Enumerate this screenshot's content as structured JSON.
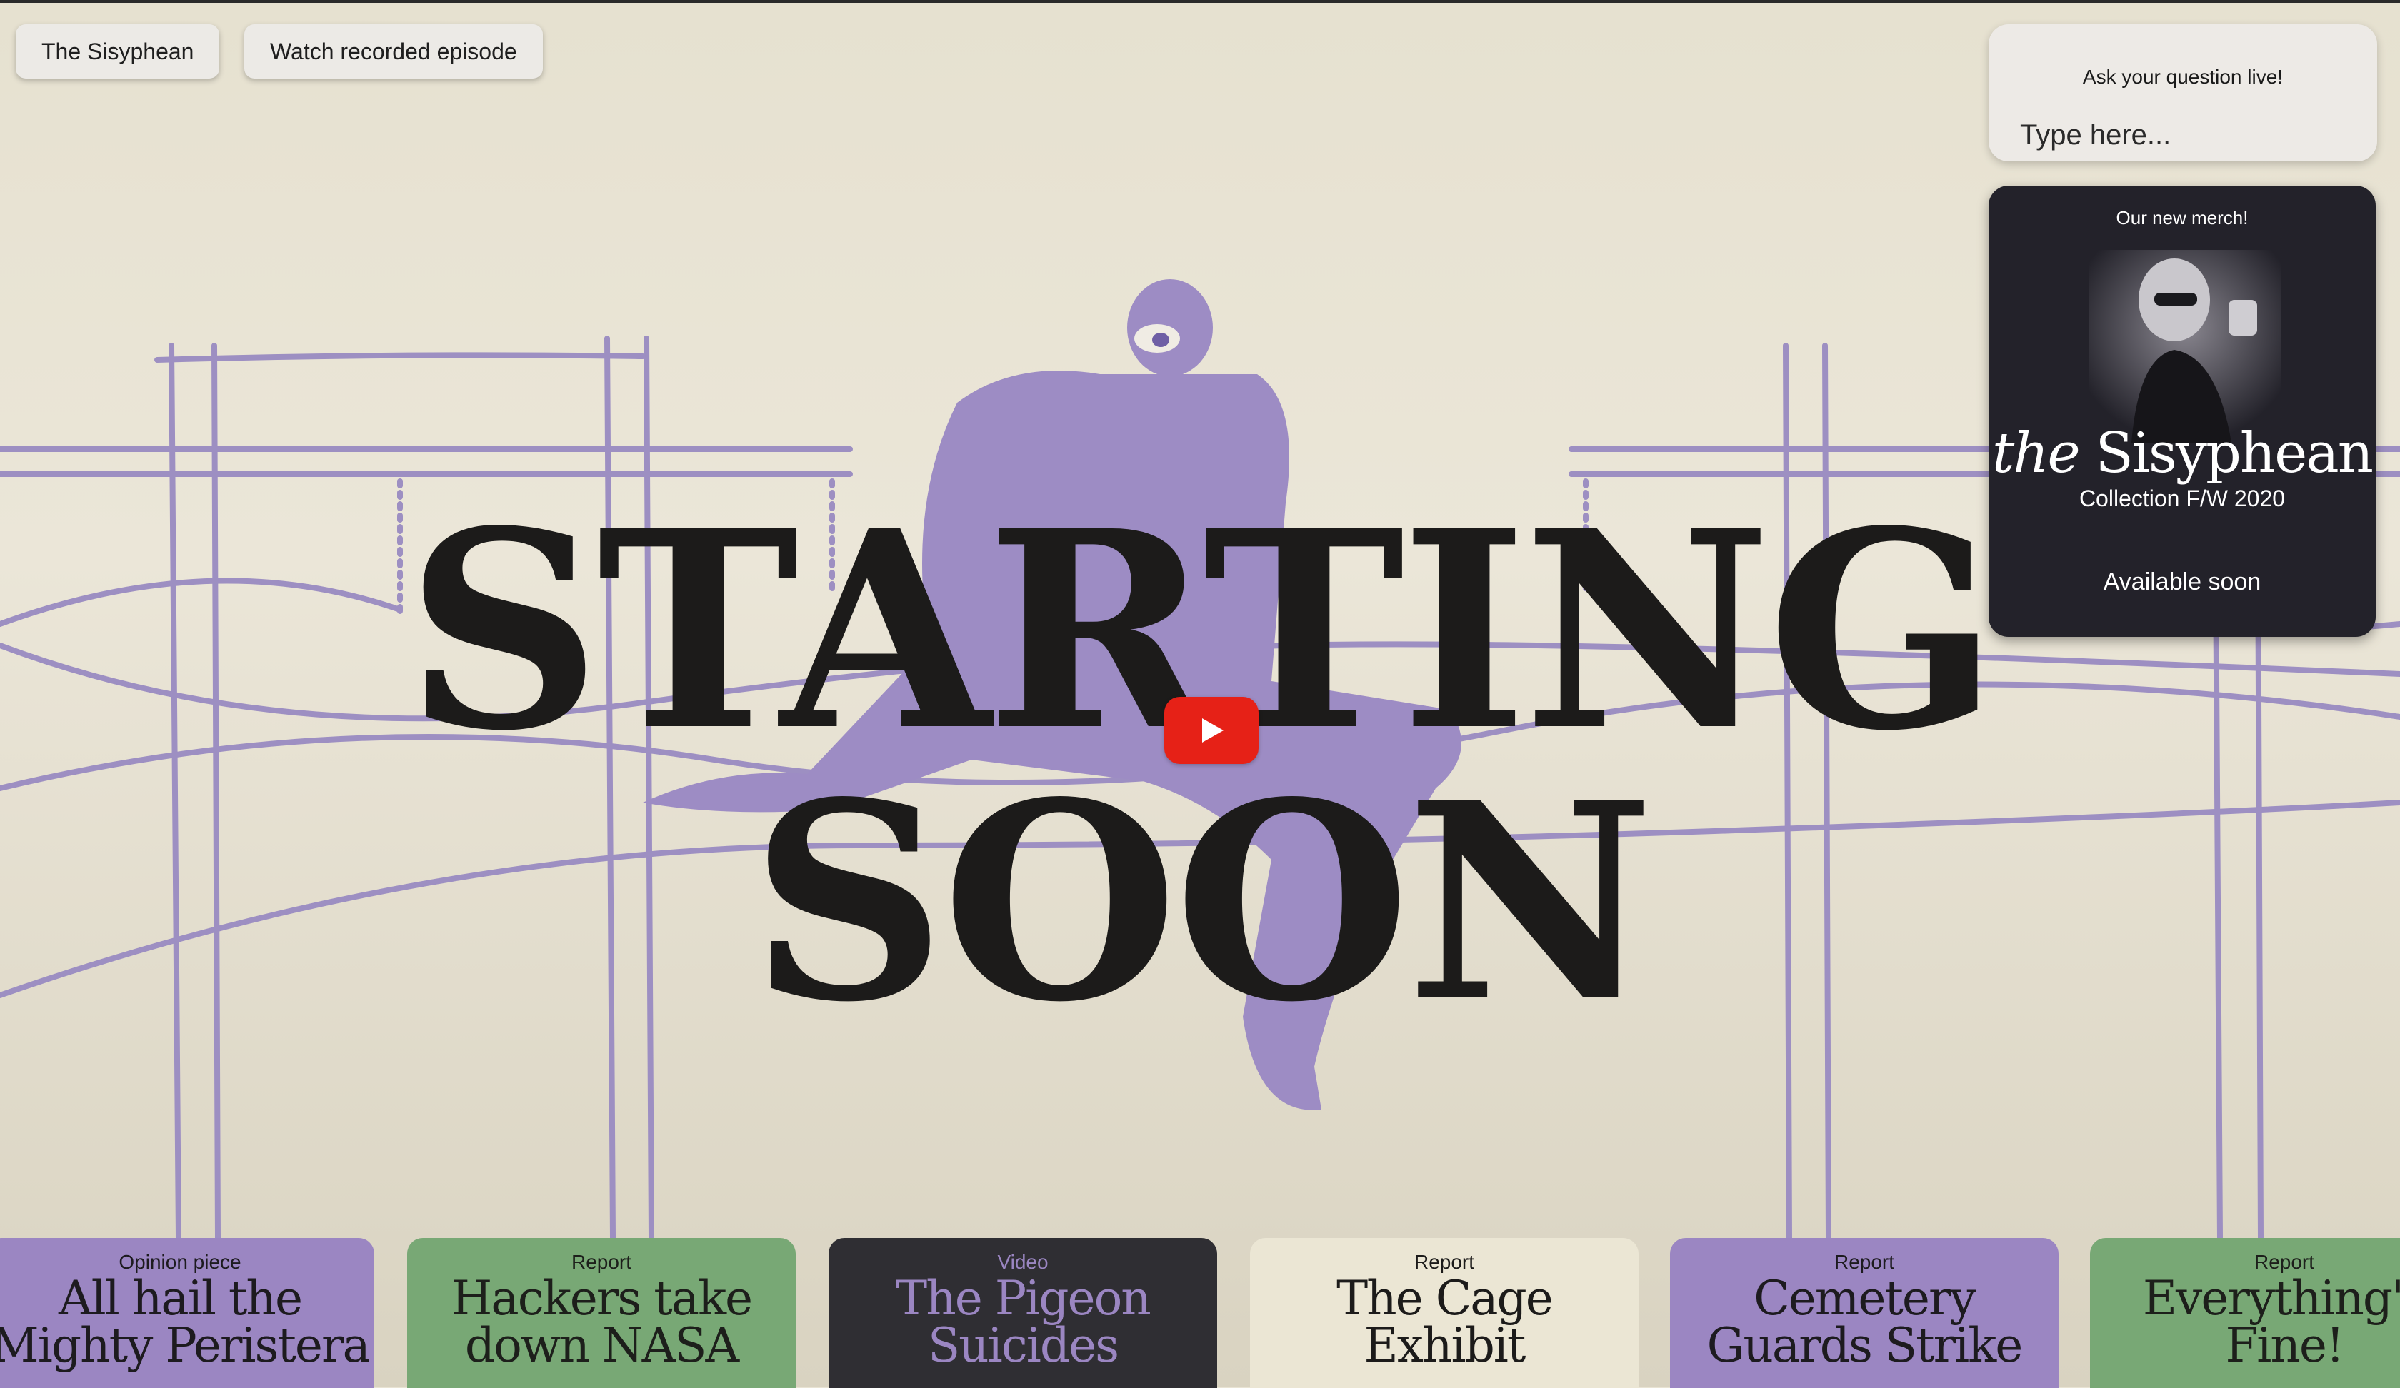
{
  "header": {
    "brand_label": "The Sisyphean",
    "watch_label": "Watch recorded episode"
  },
  "stream": {
    "line1": "STARTING",
    "line2": "SOON"
  },
  "ask": {
    "title": "Ask your question live!",
    "placeholder": "Type here..."
  },
  "merch": {
    "label": "Our new merch!",
    "wordmark_italic": "the",
    "wordmark_main": "Sisyphean",
    "collection": "Collection F/W 2020",
    "availability": "Available soon"
  },
  "cards": [
    {
      "category": "Opinion piece",
      "title1": "All hail the",
      "title2": "Mighty Peristera"
    },
    {
      "category": "Report",
      "title1": "Hackers take",
      "title2": "down NASA"
    },
    {
      "category": "Video",
      "title1": "The Pigeon",
      "title2": "Suicides"
    },
    {
      "category": "Report",
      "title1": "The Cage",
      "title2": "Exhibit"
    },
    {
      "category": "Report",
      "title1": "Cemetery",
      "title2": "Guards Strike"
    },
    {
      "category": "Report",
      "title1": "Everything's",
      "title2": "Fine!"
    }
  ],
  "colors": {
    "accent_purple": "#9b86c2",
    "accent_green": "#78a875",
    "dark": "#2f2e33",
    "cream": "#ebe6d4",
    "play_red": "#e62117"
  },
  "icons": {
    "play": "play-icon"
  }
}
